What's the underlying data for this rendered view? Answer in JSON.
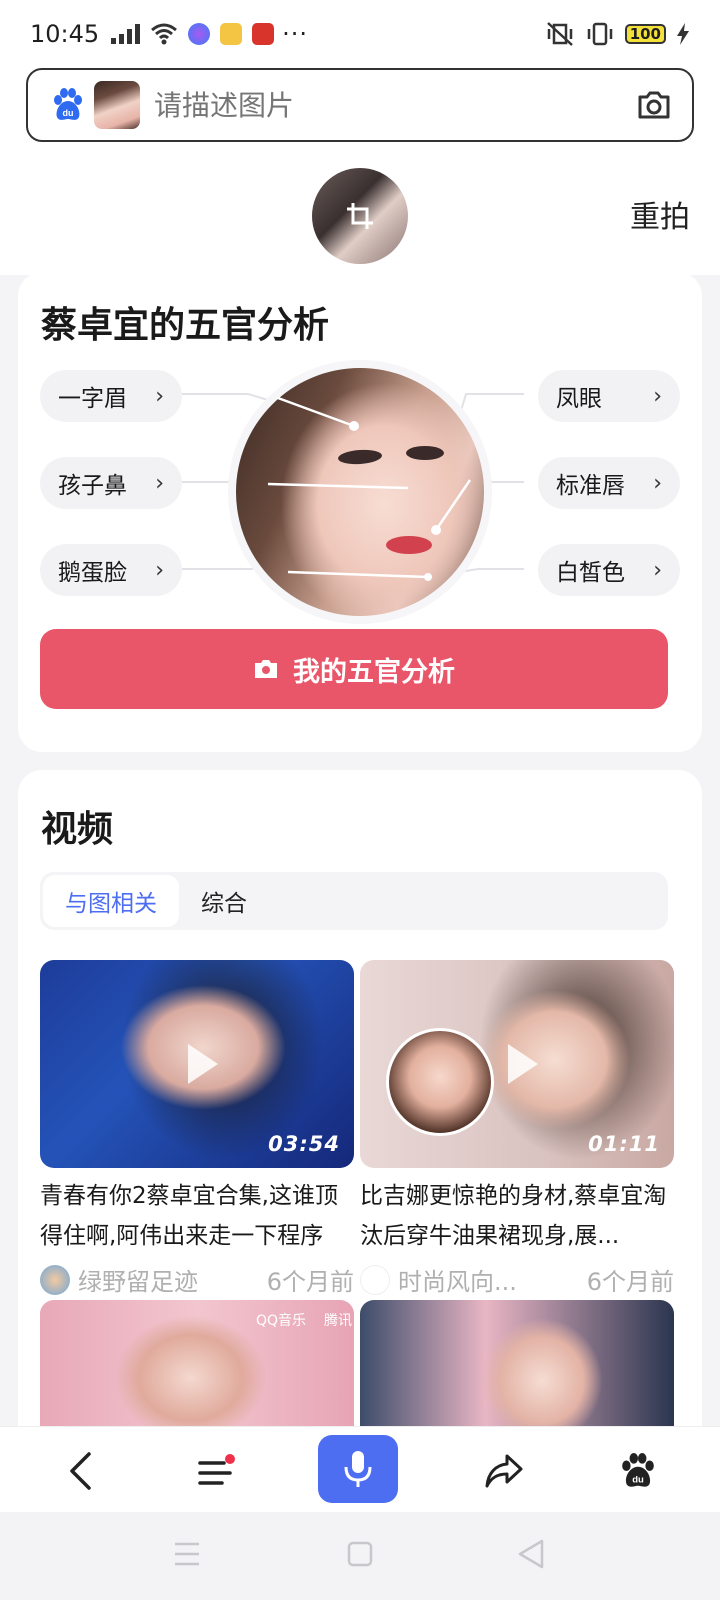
{
  "status_bar": {
    "time": "10:45",
    "battery": "100",
    "more": "···"
  },
  "search": {
    "placeholder": "请描述图片",
    "retake_label": "重拍"
  },
  "analysis": {
    "title": "蔡卓宜的五官分析",
    "left_features": [
      "一字眉",
      "孩子鼻",
      "鹅蛋脸"
    ],
    "right_features": [
      "凤眼",
      "标准唇",
      "白皙色"
    ],
    "cta_label": "我的五官分析"
  },
  "videos": {
    "title": "视频",
    "tabs": [
      {
        "label": "与图相关",
        "active": true
      },
      {
        "label": "综合",
        "active": false
      }
    ],
    "items": [
      {
        "title": "青春有你2蔡卓宜合集,这谁顶得住啊,阿伟出来走一下程序",
        "duration": "03:54",
        "author": "绿野留足迹",
        "age": "6个月前"
      },
      {
        "title": "比吉娜更惊艳的身材,蔡卓宜淘汰后穿牛油果裙现身,展...",
        "duration": "01:11",
        "author": "时尚风向...",
        "age": "6个月前"
      }
    ],
    "partial_tags": [
      "QQ音乐",
      "腾讯"
    ]
  },
  "colors": {
    "accent_blue": "#4e6ef2",
    "cta_red": "#e9566a",
    "notification_dot": "#f0304a"
  },
  "icons": {
    "back": "chevron-left-icon",
    "menu": "menu-icon",
    "mic": "microphone-icon",
    "share": "share-icon",
    "baidu": "baidu-paw-icon"
  }
}
